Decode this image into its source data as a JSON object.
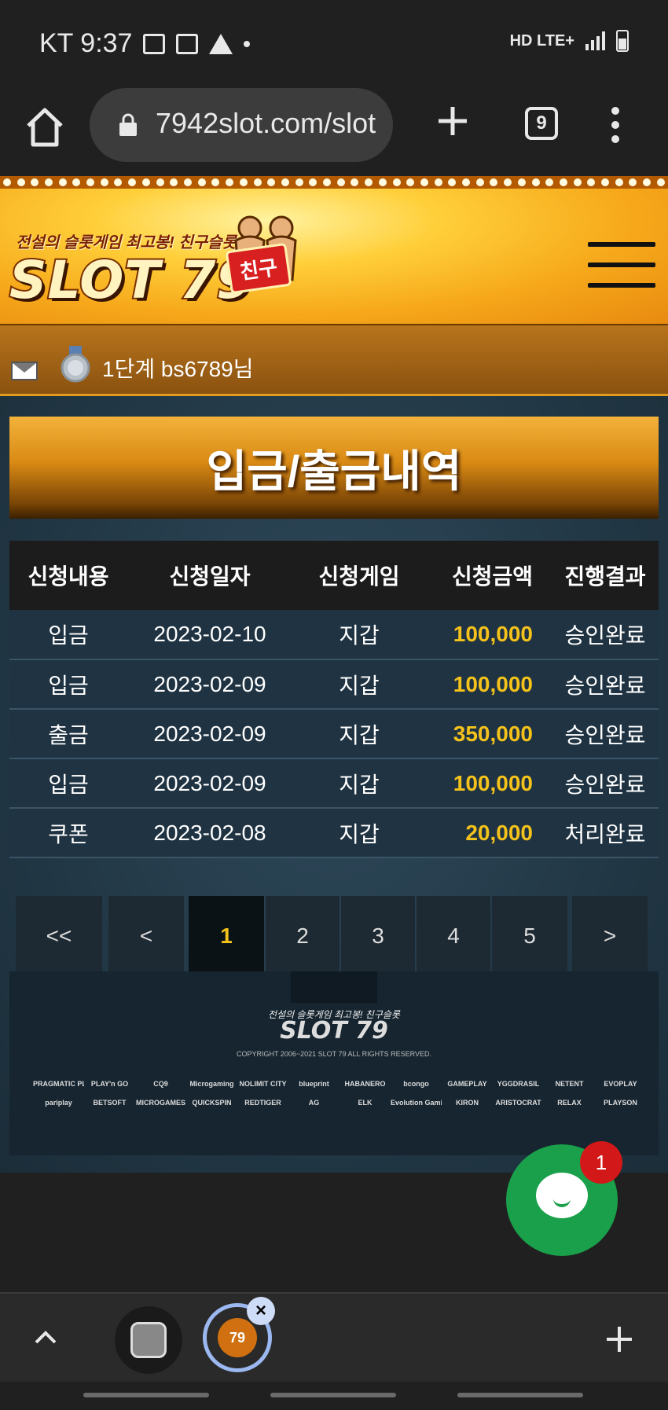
{
  "status_bar": {
    "carrier_time": "KT 9:37",
    "network": "HD LTE+"
  },
  "browser": {
    "url": "7942slot.com/slot",
    "tab_count": "9"
  },
  "header": {
    "tagline": "전설의 슬롯게임 최고봉! 친구슬롯",
    "logo": "SLOT 79",
    "logo_badge": "친구"
  },
  "user": {
    "level_name": "1단계 bs6789님"
  },
  "page": {
    "title": "입금/출금내역"
  },
  "table": {
    "headers": [
      "신청내용",
      "신청일자",
      "신청게임",
      "신청금액",
      "진행결과"
    ],
    "rows": [
      {
        "type": "입금",
        "date": "2023-02-10",
        "game": "지갑",
        "amount": "100,000",
        "result": "승인완료"
      },
      {
        "type": "입금",
        "date": "2023-02-09",
        "game": "지갑",
        "amount": "100,000",
        "result": "승인완료"
      },
      {
        "type": "출금",
        "date": "2023-02-09",
        "game": "지갑",
        "amount": "350,000",
        "result": "승인완료"
      },
      {
        "type": "입금",
        "date": "2023-02-09",
        "game": "지갑",
        "amount": "100,000",
        "result": "승인완료"
      },
      {
        "type": "쿠폰",
        "date": "2023-02-08",
        "game": "지갑",
        "amount": "20,000",
        "result": "처리완료"
      }
    ]
  },
  "pagination": {
    "first": "<<",
    "prev": "<",
    "pages": [
      "1",
      "2",
      "3",
      "4",
      "5"
    ],
    "current": "1",
    "next": ">"
  },
  "footer": {
    "tagline": "전설의 슬롯게임 최고봉! 친구슬롯",
    "logo": "SLOT 79",
    "copyright": "COPYRIGHT 2006~2021 SLOT 79 ALL RIGHTS RESERVED.",
    "providers": [
      "PRAGMATIC PLAY",
      "PLAY'n GO",
      "CQ9",
      "Microgaming",
      "NOLIMIT CITY",
      "blueprint",
      "HABANERO",
      "bcongo",
      "GAMEPLAY",
      "YGGDRASIL",
      "NETENT",
      "EVOPLAY",
      "pariplay",
      "BETSOFT",
      "MICROGAMES",
      "QUICKSPIN",
      "REDTIGER",
      "AG",
      "ELK",
      "Evolution Gaming",
      "KIRON",
      "ARISTOCRAT",
      "RELAX",
      "PLAYSON"
    ]
  },
  "chat": {
    "badge_count": "1"
  },
  "tab_strip": {
    "active_tab_label": "79"
  },
  "colors": {
    "accent_gold": "#f4c21a",
    "chat_green": "#1aa04a",
    "badge_red": "#d21818"
  }
}
